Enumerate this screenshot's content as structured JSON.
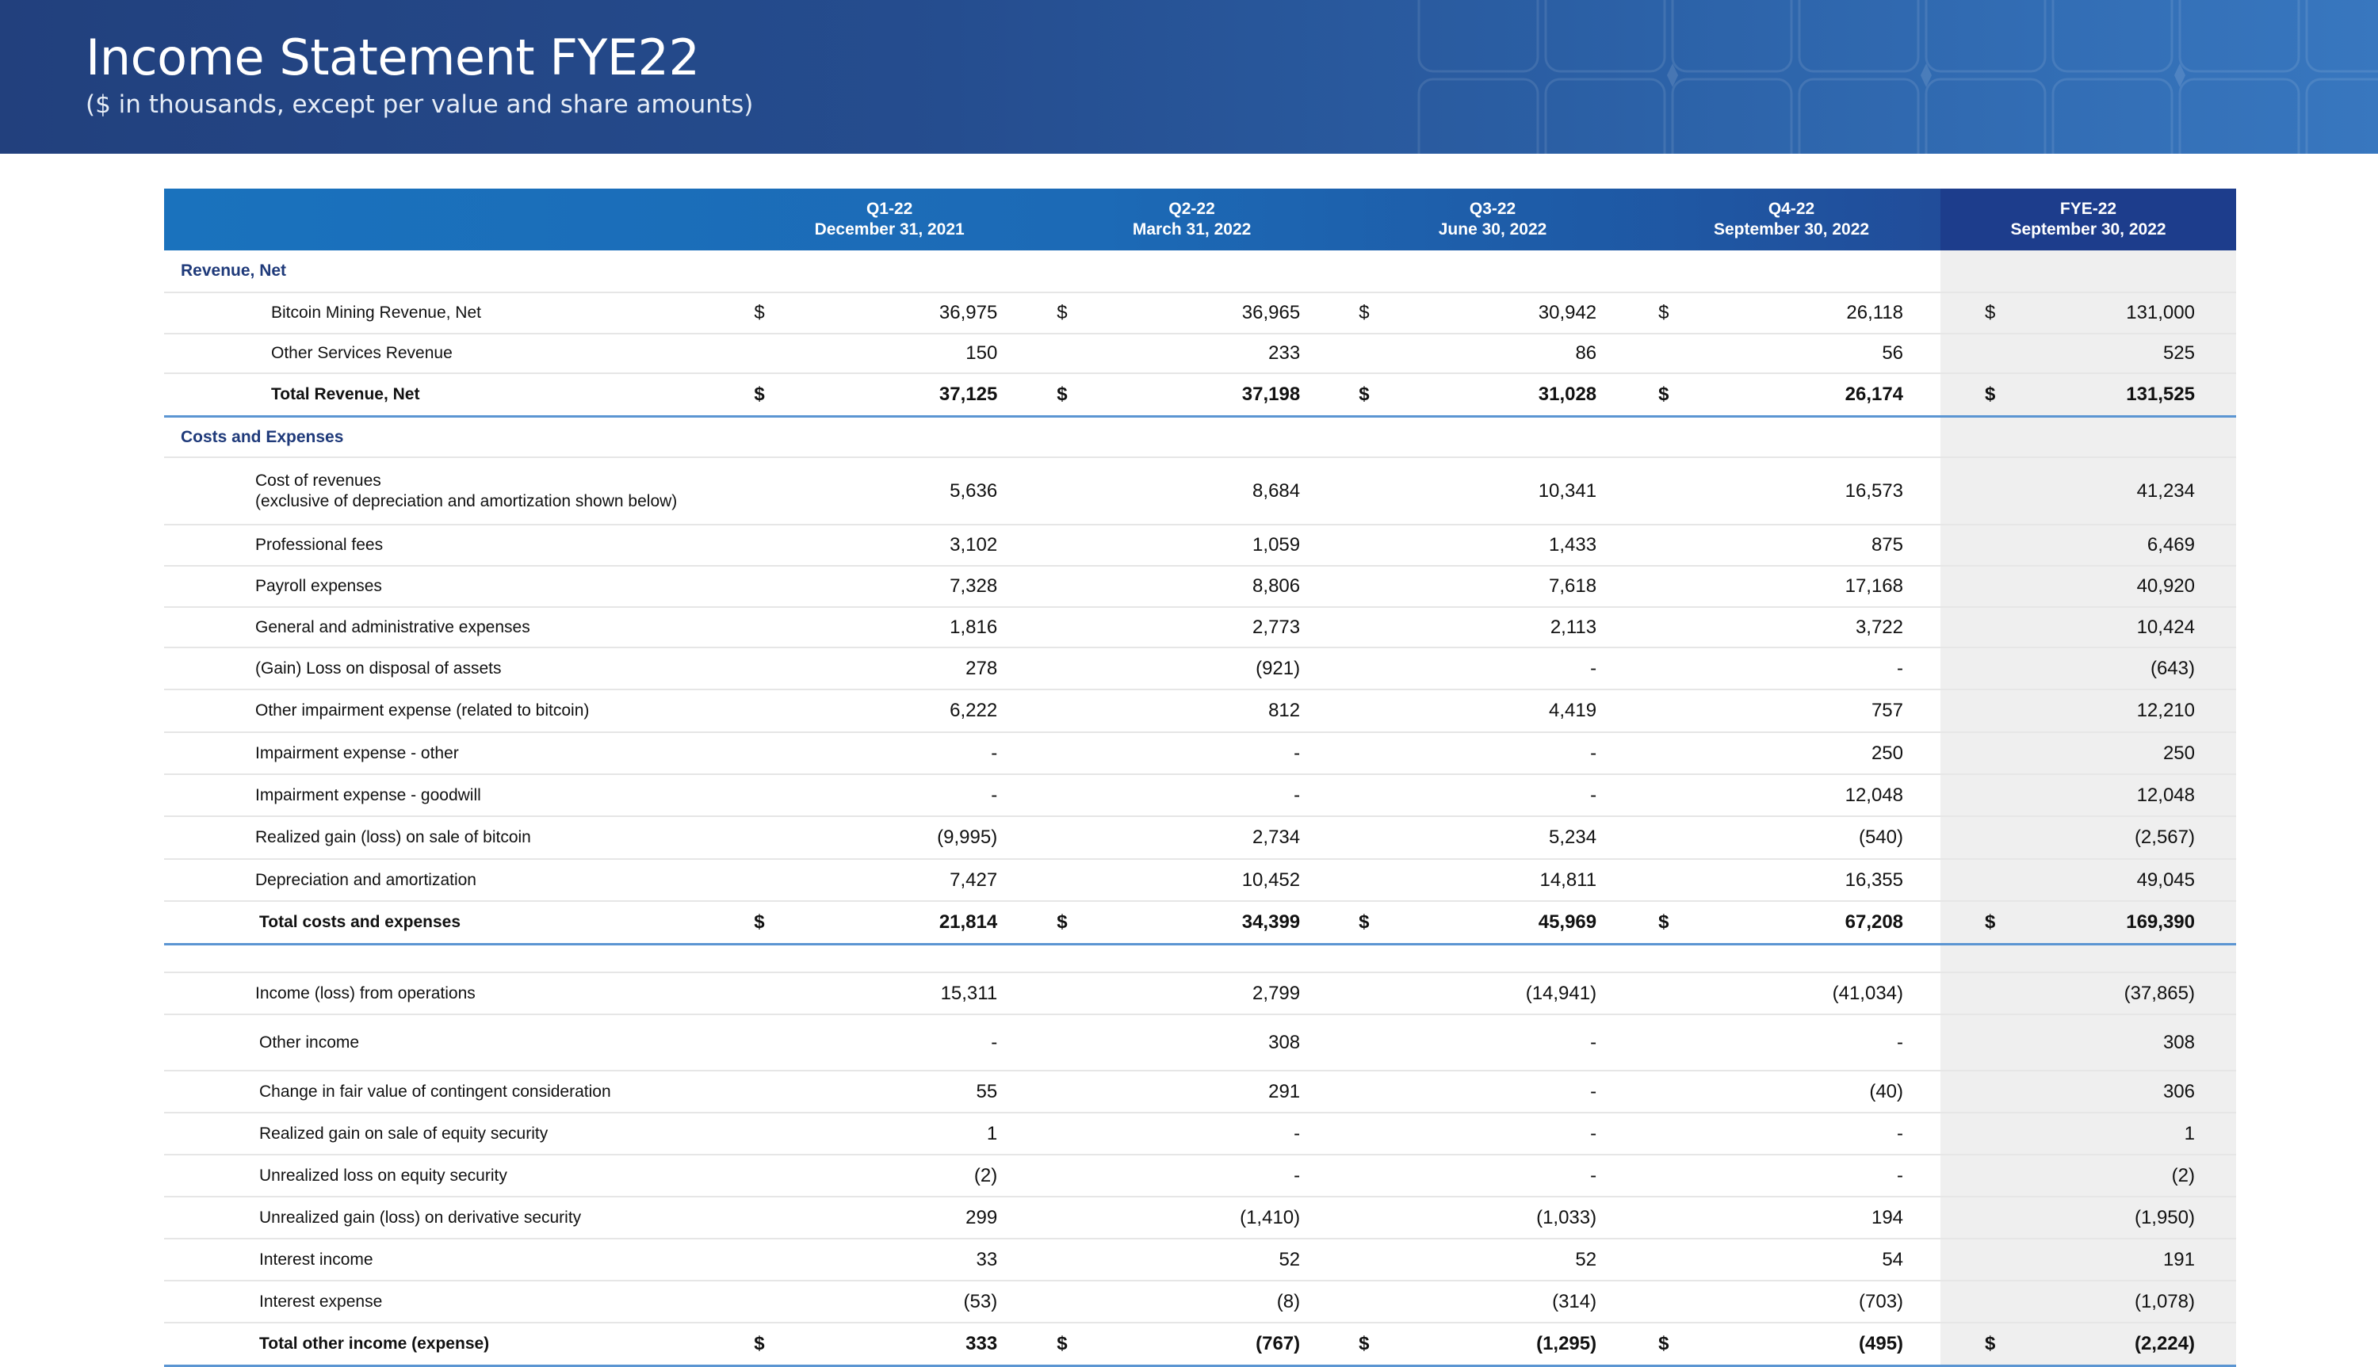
{
  "header": {
    "title": "Income Statement FYE22",
    "subtitle": "($ in thousands, except per value and share amounts)"
  },
  "colors": {
    "banner": "#254d8f",
    "table_header": "#1a72bd",
    "fye_header": "#1d3d8c",
    "section_text": "#1f3a7a",
    "total_rule": "#5b95d2",
    "fye_shade": "#efefef"
  },
  "columns": [
    {
      "name": "Q1-22",
      "date": "December 31, 2021"
    },
    {
      "name": "Q2-22",
      "date": "March 31, 2022"
    },
    {
      "name": "Q3-22",
      "date": "June 30, 2022"
    },
    {
      "name": "Q4-22",
      "date": "September 30, 2022"
    },
    {
      "name": "FYE-22",
      "date": "September 30, 2022"
    }
  ],
  "currency_symbol": "$",
  "rows": [
    {
      "type": "section",
      "label": "Revenue, Net",
      "h": 52
    },
    {
      "type": "line",
      "label": "Bitcoin Mining Revenue, Net",
      "values": [
        "36,975",
        "36,965",
        "30,942",
        "26,118",
        "131,000"
      ],
      "dollar": true,
      "indent": "i3",
      "h": 50
    },
    {
      "type": "line",
      "label": "Other Services Revenue",
      "values": [
        "150",
        "233",
        "86",
        "56",
        "525"
      ],
      "indent": "i3",
      "h": 48
    },
    {
      "type": "total",
      "label": "Total Revenue, Net",
      "values": [
        "37,125",
        "37,198",
        "31,028",
        "26,174",
        "131,525"
      ],
      "dollar": true,
      "indent": "i3",
      "h": 52
    },
    {
      "type": "section",
      "label": "Costs and Expenses",
      "h": 49
    },
    {
      "type": "line",
      "label": "Cost of revenues\n(exclusive of depreciation and amortization shown below)",
      "values": [
        "5,636",
        "8,684",
        "10,341",
        "16,573",
        "41,234"
      ],
      "indent": "i2",
      "h": 83
    },
    {
      "type": "line",
      "label": "Professional fees",
      "values": [
        "3,102",
        "1,059",
        "1,433",
        "875",
        "6,469"
      ],
      "indent": "i2",
      "h": 50
    },
    {
      "type": "line",
      "label": "Payroll expenses",
      "values": [
        "7,328",
        "8,806",
        "7,618",
        "17,168",
        "40,920"
      ],
      "indent": "i2",
      "h": 50
    },
    {
      "type": "line",
      "label": "General and administrative expenses",
      "values": [
        "1,816",
        "2,773",
        "2,113",
        "3,722",
        "10,424"
      ],
      "indent": "i2",
      "h": 49
    },
    {
      "type": "line",
      "label": "(Gain) Loss on disposal of assets",
      "values": [
        "278",
        "(921)",
        "-",
        "-",
        "(643)"
      ],
      "indent": "i2",
      "h": 51
    },
    {
      "type": "line",
      "label": "Other impairment expense (related to bitcoin)",
      "values": [
        "6,222",
        "812",
        "4,419",
        "757",
        "12,210"
      ],
      "indent": "i2",
      "h": 52
    },
    {
      "type": "line",
      "label": "Impairment expense - other",
      "values": [
        "-",
        "-",
        "-",
        "250",
        "250"
      ],
      "indent": "i2",
      "h": 51
    },
    {
      "type": "line",
      "label": "Impairment expense - goodwill",
      "values": [
        "-",
        "-",
        "-",
        "12,048",
        "12,048"
      ],
      "indent": "i2",
      "h": 51
    },
    {
      "type": "line",
      "label": "Realized gain (loss) on sale of bitcoin",
      "values": [
        "(9,995)",
        "2,734",
        "5,234",
        "(540)",
        "(2,567)"
      ],
      "indent": "i2",
      "h": 52
    },
    {
      "type": "line",
      "label": "Depreciation and amortization",
      "values": [
        "7,427",
        "10,452",
        "14,811",
        "16,355",
        "49,045"
      ],
      "indent": "i2",
      "h": 51
    },
    {
      "type": "total",
      "label": "Total costs and expenses",
      "values": [
        "21,814",
        "34,399",
        "45,969",
        "67,208",
        "169,390"
      ],
      "dollar": true,
      "indent": "i4",
      "h": 52
    },
    {
      "type": "blank",
      "label": "",
      "h": 33
    },
    {
      "type": "line",
      "label": "Income (loss) from operations",
      "values": [
        "15,311",
        "2,799",
        "(14,941)",
        "(41,034)",
        "(37,865)"
      ],
      "indent": "i2",
      "h": 51
    },
    {
      "type": "line",
      "label": "Other income",
      "values": [
        "-",
        "308",
        "-",
        "-",
        "308"
      ],
      "indent": "i4",
      "h": 69
    },
    {
      "type": "line",
      "label": "Change in fair value of contingent consideration",
      "values": [
        "55",
        "291",
        "-",
        "(40)",
        "306"
      ],
      "indent": "i4",
      "h": 51
    },
    {
      "type": "line",
      "label": "Realized gain on sale of equity security",
      "values": [
        "1",
        "-",
        "-",
        "-",
        "1"
      ],
      "indent": "i4",
      "h": 51
    },
    {
      "type": "line",
      "label": "Unrealized loss on equity security",
      "values": [
        "(2)",
        "-",
        "-",
        "-",
        "(2)"
      ],
      "indent": "i4",
      "h": 51
    },
    {
      "type": "line",
      "label": "Unrealized gain (loss) on derivative security",
      "values": [
        "299",
        "(1,410)",
        "(1,033)",
        "194",
        "(1,950)"
      ],
      "indent": "i4",
      "h": 51
    },
    {
      "type": "line",
      "label": "Interest income",
      "values": [
        "33",
        "52",
        "52",
        "54",
        "191"
      ],
      "indent": "i4",
      "h": 51
    },
    {
      "type": "line",
      "label": "Interest expense",
      "values": [
        "(53)",
        "(8)",
        "(314)",
        "(703)",
        "(1,078)"
      ],
      "indent": "i4",
      "h": 51
    },
    {
      "type": "total",
      "label": "Total other income (expense)",
      "values": [
        "333",
        "(767)",
        "(1,295)",
        "(495)",
        "(2,224)"
      ],
      "dollar": true,
      "indent": "i4",
      "h": 52
    }
  ]
}
